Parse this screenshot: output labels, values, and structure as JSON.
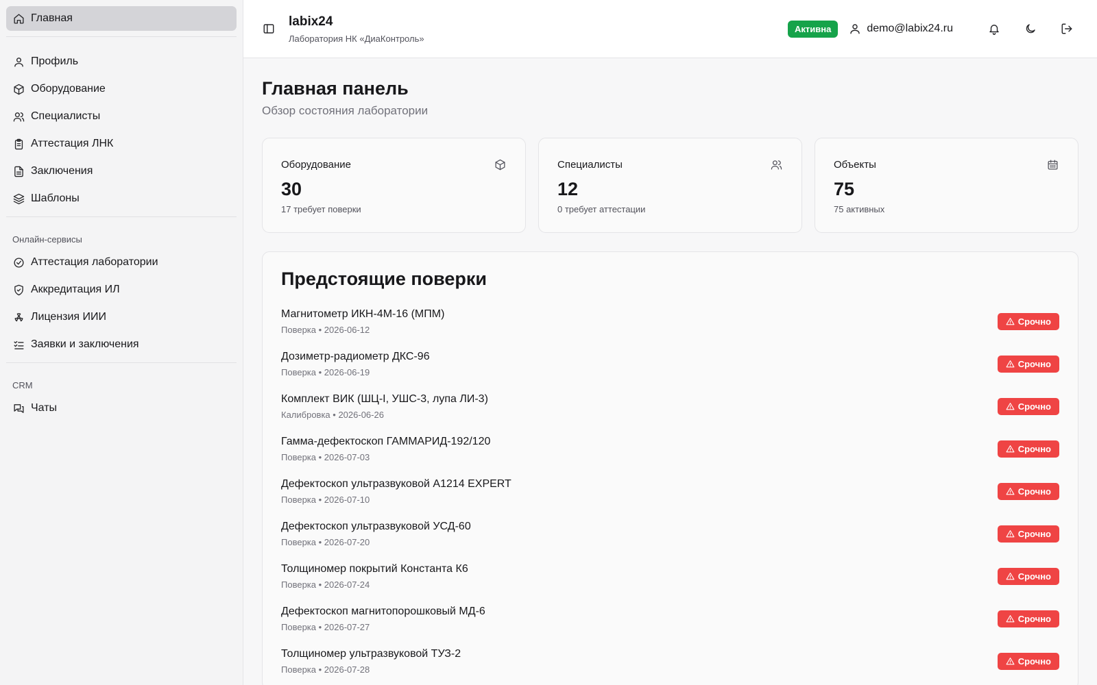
{
  "sidebar": {
    "home": {
      "label": "Главная",
      "icon": "home-icon"
    },
    "items": [
      {
        "label": "Профиль",
        "icon": "user-icon"
      },
      {
        "label": "Оборудование",
        "icon": "box-icon"
      },
      {
        "label": "Специалисты",
        "icon": "users-icon"
      },
      {
        "label": "Аттестация ЛНК",
        "icon": "clipboard-icon"
      },
      {
        "label": "Заключения",
        "icon": "file-icon"
      },
      {
        "label": "Шаблоны",
        "icon": "layers-icon"
      }
    ],
    "online_section": {
      "label": "Онлайн-сервисы",
      "items": [
        {
          "label": "Аттестация лаборатории",
          "icon": "check-circle-icon"
        },
        {
          "label": "Аккредитация ИЛ",
          "icon": "shield-icon"
        },
        {
          "label": "Лицензия ИИИ",
          "icon": "radiation-icon"
        },
        {
          "label": "Заявки и заключения",
          "icon": "list-checks-icon"
        }
      ]
    },
    "crm_section": {
      "label": "CRM",
      "items": [
        {
          "label": "Чаты",
          "icon": "chats-icon"
        }
      ]
    }
  },
  "header": {
    "title": "labix24",
    "subtitle": "Лаборатория НК «ДиаКонтроль»",
    "status": "Активна",
    "user_email": "demo@labix24.ru"
  },
  "page": {
    "title": "Главная панель",
    "subtitle": "Обзор состояния лаборатории"
  },
  "cards": [
    {
      "title": "Оборудование",
      "value": "30",
      "note": "17 требует поверки",
      "icon": "box-icon"
    },
    {
      "title": "Специалисты",
      "value": "12",
      "note": "0 требует аттестации",
      "icon": "users-icon"
    },
    {
      "title": "Объекты",
      "value": "75",
      "note": "75 активных",
      "icon": "calendar-icon"
    }
  ],
  "upcoming": {
    "title": "Предстоящие поверки",
    "badge_label": "Срочно",
    "items": [
      {
        "name": "Магнитометр ИКН-4М-16 (МПМ)",
        "meta": "Поверка • 2026-06-12"
      },
      {
        "name": "Дозиметр-радиометр ДКС-96",
        "meta": "Поверка • 2026-06-19"
      },
      {
        "name": "Комплект ВИК (ШЦ-I, УШС-3, лупа ЛИ-3)",
        "meta": "Калибровка • 2026-06-26"
      },
      {
        "name": "Гамма-дефектоскоп ГАММАРИД-192/120",
        "meta": "Поверка • 2026-07-03"
      },
      {
        "name": "Дефектоскоп ультразвуковой А1214 EXPERT",
        "meta": "Поверка • 2026-07-10"
      },
      {
        "name": "Дефектоскоп ультразвуковой УСД-60",
        "meta": "Поверка • 2026-07-20"
      },
      {
        "name": "Толщиномер покрытий Константа К6",
        "meta": "Поверка • 2026-07-24"
      },
      {
        "name": "Дефектоскоп магнитопорошковый МД-6",
        "meta": "Поверка • 2026-07-27"
      },
      {
        "name": "Толщиномер ультразвуковой ТУЗ-2",
        "meta": "Поверка • 2026-07-28"
      }
    ]
  },
  "colors": {
    "status_active": "#16a34a",
    "urgent": "#ef4444",
    "sidebar_active": "#d4d4d8"
  }
}
